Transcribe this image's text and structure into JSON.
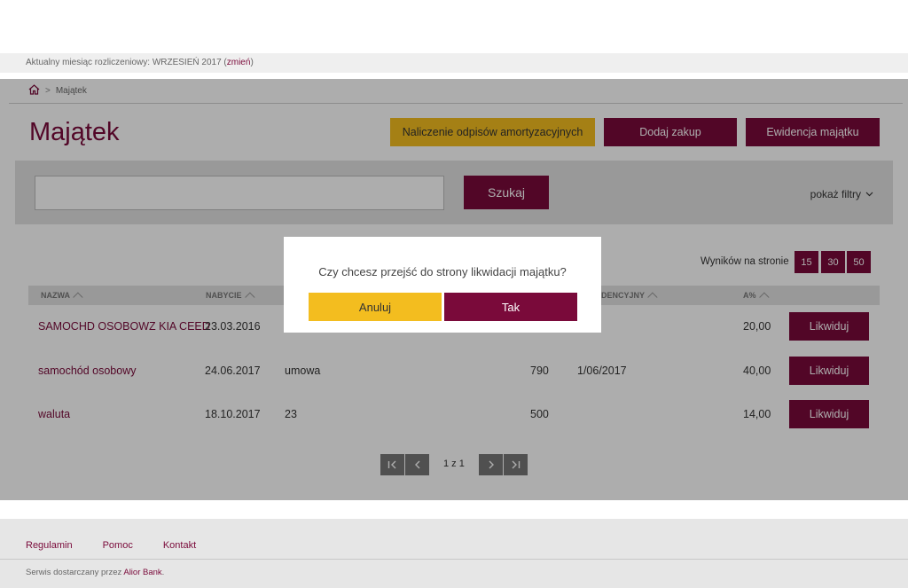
{
  "billing": {
    "label": "Aktualny miesiąc rozliczeniowy: WRZESIEŃ 2017 (",
    "change_link": "zmień",
    "suffix": ")"
  },
  "breadcrumb": {
    "home_icon": "home-icon",
    "current": "Majątek"
  },
  "page": {
    "title": "Majątek"
  },
  "actions": {
    "depreciation": "Naliczenie odpisów amortyzacyjnych",
    "add_purchase": "Dodaj zakup",
    "asset_register": "Ewidencja majątku"
  },
  "search": {
    "value": "",
    "button": "Szukaj",
    "filters": "pokaż filtry"
  },
  "results": {
    "label": "Wyników na stronie",
    "options": [
      "15",
      "30",
      "50"
    ]
  },
  "table": {
    "headers": {
      "name": "NAZWA",
      "acquired": "NABYCIE",
      "registry": "DENCYJNY",
      "rate": "A%"
    },
    "rows": [
      {
        "name": "SAMOCHD OSOBOWZ KIA CEED",
        "date": "23.03.2016",
        "doc": "",
        "value": "",
        "registry": "",
        "rate": "20,00",
        "action": "Likwiduj"
      },
      {
        "name": "samochód osobowy",
        "date": "24.06.2017",
        "doc": "umowa",
        "value": "790",
        "registry": "1/06/2017",
        "rate": "40,00",
        "action": "Likwiduj"
      },
      {
        "name": "waluta",
        "date": "18.10.2017",
        "doc": "23",
        "value": "500",
        "registry": "",
        "rate": "14,00",
        "action": "Likwiduj"
      }
    ]
  },
  "pagination": {
    "text": "1 z 1"
  },
  "modal": {
    "question": "Czy chcesz przejść do strony likwidacji majątku?",
    "cancel": "Anuluj",
    "confirm": "Tak"
  },
  "footer": {
    "links": [
      "Regulamin",
      "Pomoc",
      "Kontakt"
    ],
    "note": "Serwis dostarczany przez ",
    "bank": "Alior Bank",
    "note_end": "."
  },
  "colors": {
    "brand": "#7a0a3a",
    "accent": "#f3bd1f"
  }
}
